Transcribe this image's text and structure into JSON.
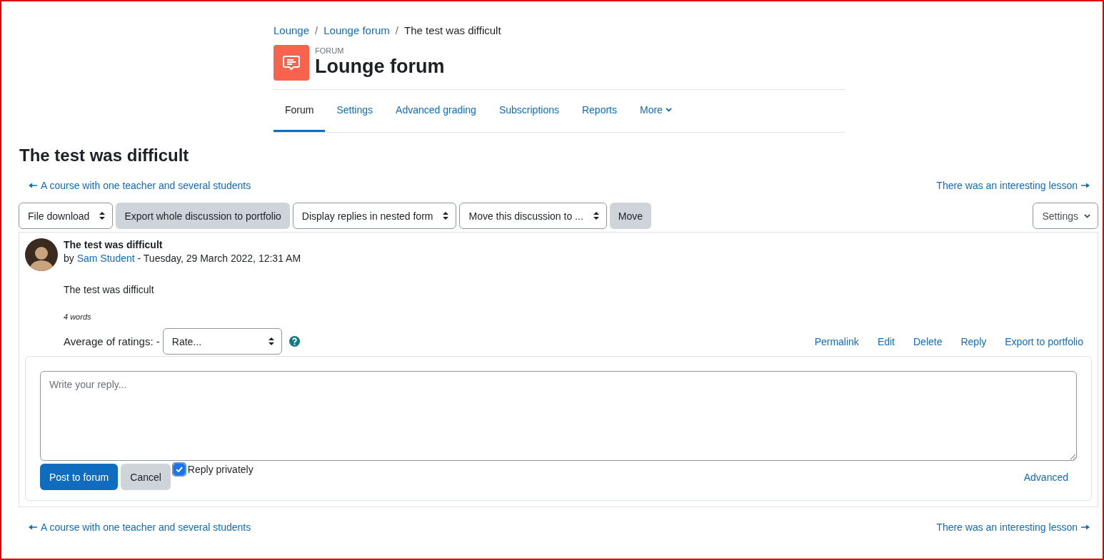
{
  "breadcrumb": [
    {
      "label": "Lounge",
      "kind": "link"
    },
    {
      "label": "Lounge forum",
      "kind": "link"
    },
    {
      "label": "The test was difficult",
      "kind": "current"
    }
  ],
  "breadcrumb_separator": "/",
  "header": {
    "category": "FORUM",
    "title": "Lounge forum"
  },
  "tabs": [
    {
      "label": "Forum",
      "selected": true,
      "kind": "tab"
    },
    {
      "label": "Settings",
      "selected": false,
      "kind": "tab"
    },
    {
      "label": "Advanced grading",
      "selected": false,
      "kind": "tab"
    },
    {
      "label": "Subscriptions",
      "selected": false,
      "kind": "tab"
    },
    {
      "label": "Reports",
      "selected": false,
      "kind": "tab"
    },
    {
      "label": "More",
      "selected": false,
      "kind": "menu"
    }
  ],
  "discussion_title": "The test was difficult",
  "nav_top": {
    "previous": "A course with one teacher and several students",
    "next": "There was an interesting lesson"
  },
  "toolbar": [
    {
      "label": "File download",
      "kind": "select"
    },
    {
      "label": "Export whole discussion to portfolio",
      "kind": "button"
    },
    {
      "label": "Display replies in nested form",
      "kind": "select"
    },
    {
      "label": "Move this discussion to ...",
      "kind": "select"
    },
    {
      "label": "Move",
      "kind": "button"
    }
  ],
  "settings_menu": "Settings",
  "post": {
    "subject": "The test was difficult",
    "author_prefix": "by",
    "author": "Sam Student",
    "date": "- Tuesday, 29 March 2022, 12:31 AM",
    "message": "The test was difficult",
    "word_count": "4 words",
    "rating_label": "Average of ratings: -",
    "rating_select": "Rate...",
    "actions": [
      "Permalink",
      "Edit",
      "Delete",
      "Reply",
      "Export to portfolio"
    ]
  },
  "reply_form": {
    "placeholder": "Write your reply...",
    "buttons": [
      {
        "label": "Post to forum",
        "kind": "primary"
      },
      {
        "label": "Cancel",
        "kind": "secondary"
      }
    ],
    "reply_privately": {
      "label": "Reply privately",
      "checked": true
    },
    "advanced": "Advanced"
  },
  "nav_bottom": {
    "previous": "A course with one teacher and several students",
    "next": "There was an interesting lesson"
  }
}
